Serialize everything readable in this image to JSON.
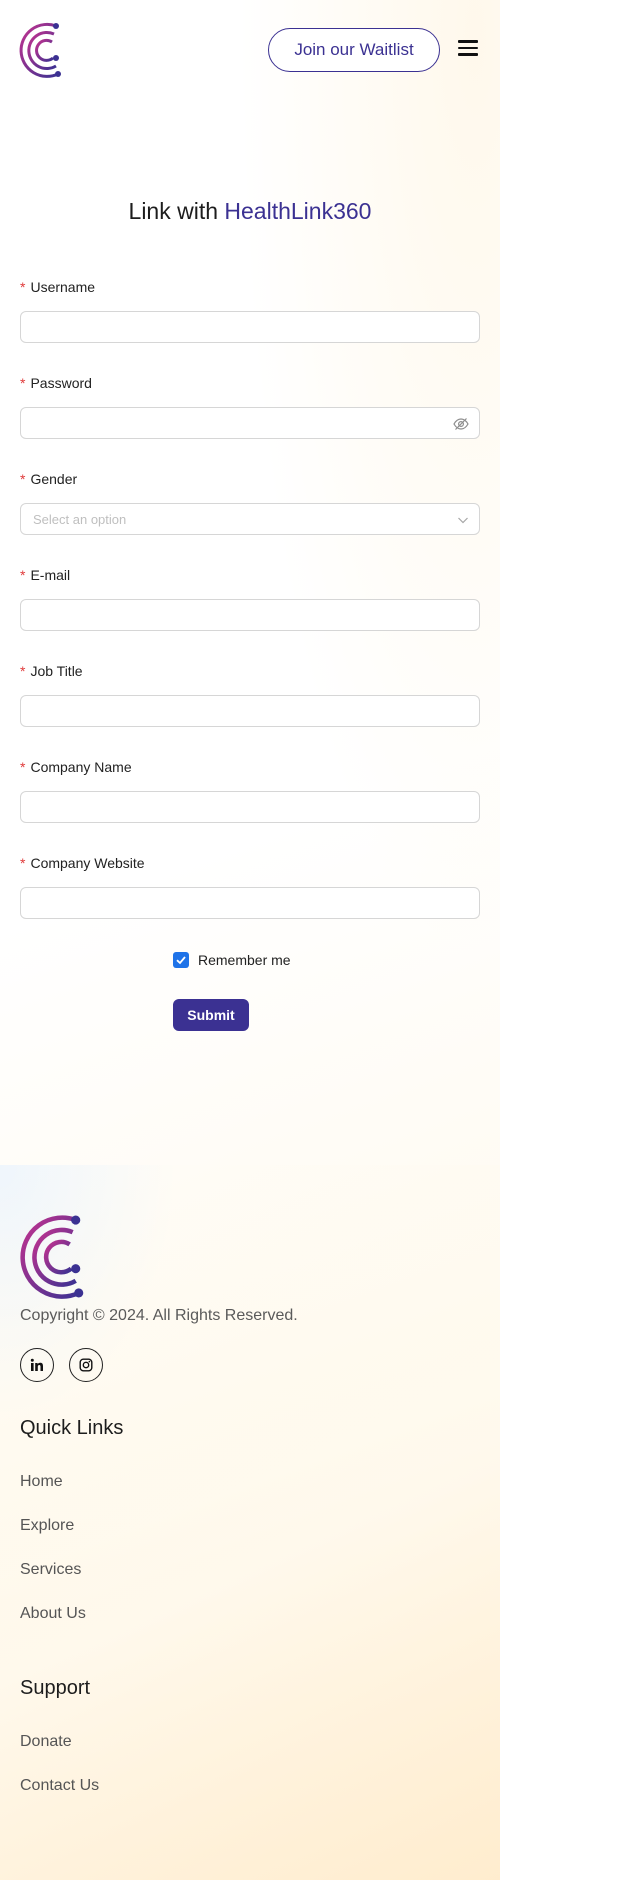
{
  "header": {
    "waitlist_label": "Join our Waitlist"
  },
  "form": {
    "title_prefix": "Link with",
    "title_brand": "HealthLink360",
    "required_mark": "*",
    "fields": [
      {
        "label": "Username"
      },
      {
        "label": "Password"
      },
      {
        "label": "Gender",
        "placeholder": "Select an option"
      },
      {
        "label": "E-mail"
      },
      {
        "label": "Job Title"
      },
      {
        "label": "Company Name"
      },
      {
        "label": "Company Website"
      }
    ],
    "remember_label": "Remember me",
    "remember_checked": true,
    "submit_label": "Submit"
  },
  "footer": {
    "copyright": "Copyright © 2024. All Rights Reserved.",
    "social_icons": [
      "linkedin-icon",
      "instagram-icon"
    ],
    "quick_links_heading": "Quick Links",
    "quick_links": [
      "Home",
      "Explore",
      "Services",
      "About Us"
    ],
    "support_heading": "Support",
    "support_links": [
      "Donate",
      "Contact Us"
    ]
  },
  "colors": {
    "brand": "#3b3192",
    "required": "#e03a3a",
    "checkbox": "#1f73e8",
    "logo_gradient_start": "#c2338f",
    "logo_gradient_end": "#3b3192"
  }
}
